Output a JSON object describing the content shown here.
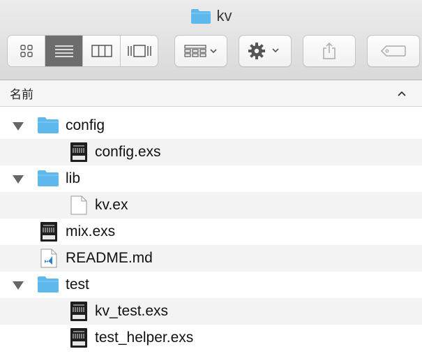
{
  "window": {
    "title": "kv",
    "title_icon": "folder-icon"
  },
  "toolbar": {
    "view_buttons": [
      {
        "name": "icon-view",
        "icon": "grid-icon",
        "active": false
      },
      {
        "name": "list-view",
        "icon": "list-icon",
        "active": true
      },
      {
        "name": "column-view",
        "icon": "columns-icon",
        "active": false
      },
      {
        "name": "gallery-view",
        "icon": "cover-flow-icon",
        "active": false
      }
    ],
    "group_icon": "group-grid-icon",
    "action_icon": "gear-icon",
    "share_icon": "share-icon",
    "tags_icon": "tag-icon"
  },
  "columns": {
    "name_header": "名前",
    "sort_icon": "chevron-up-icon"
  },
  "colors": {
    "folder": "#5fb8ec",
    "active_segment": "#6d6d6d",
    "row_alt": "#f3f3f3"
  },
  "files": [
    {
      "label": "config",
      "kind": "folder",
      "depth": 0,
      "expanded": true
    },
    {
      "label": "config.exs",
      "kind": "exs",
      "depth": 1
    },
    {
      "label": "lib",
      "kind": "folder",
      "depth": 0,
      "expanded": true
    },
    {
      "label": "kv.ex",
      "kind": "blank",
      "depth": 1
    },
    {
      "label": "mix.exs",
      "kind": "exs",
      "depth": 0
    },
    {
      "label": "README.md",
      "kind": "vscode",
      "depth": 0
    },
    {
      "label": "test",
      "kind": "folder",
      "depth": 0,
      "expanded": true
    },
    {
      "label": "kv_test.exs",
      "kind": "exs",
      "depth": 1
    },
    {
      "label": "test_helper.exs",
      "kind": "exs",
      "depth": 1
    }
  ]
}
